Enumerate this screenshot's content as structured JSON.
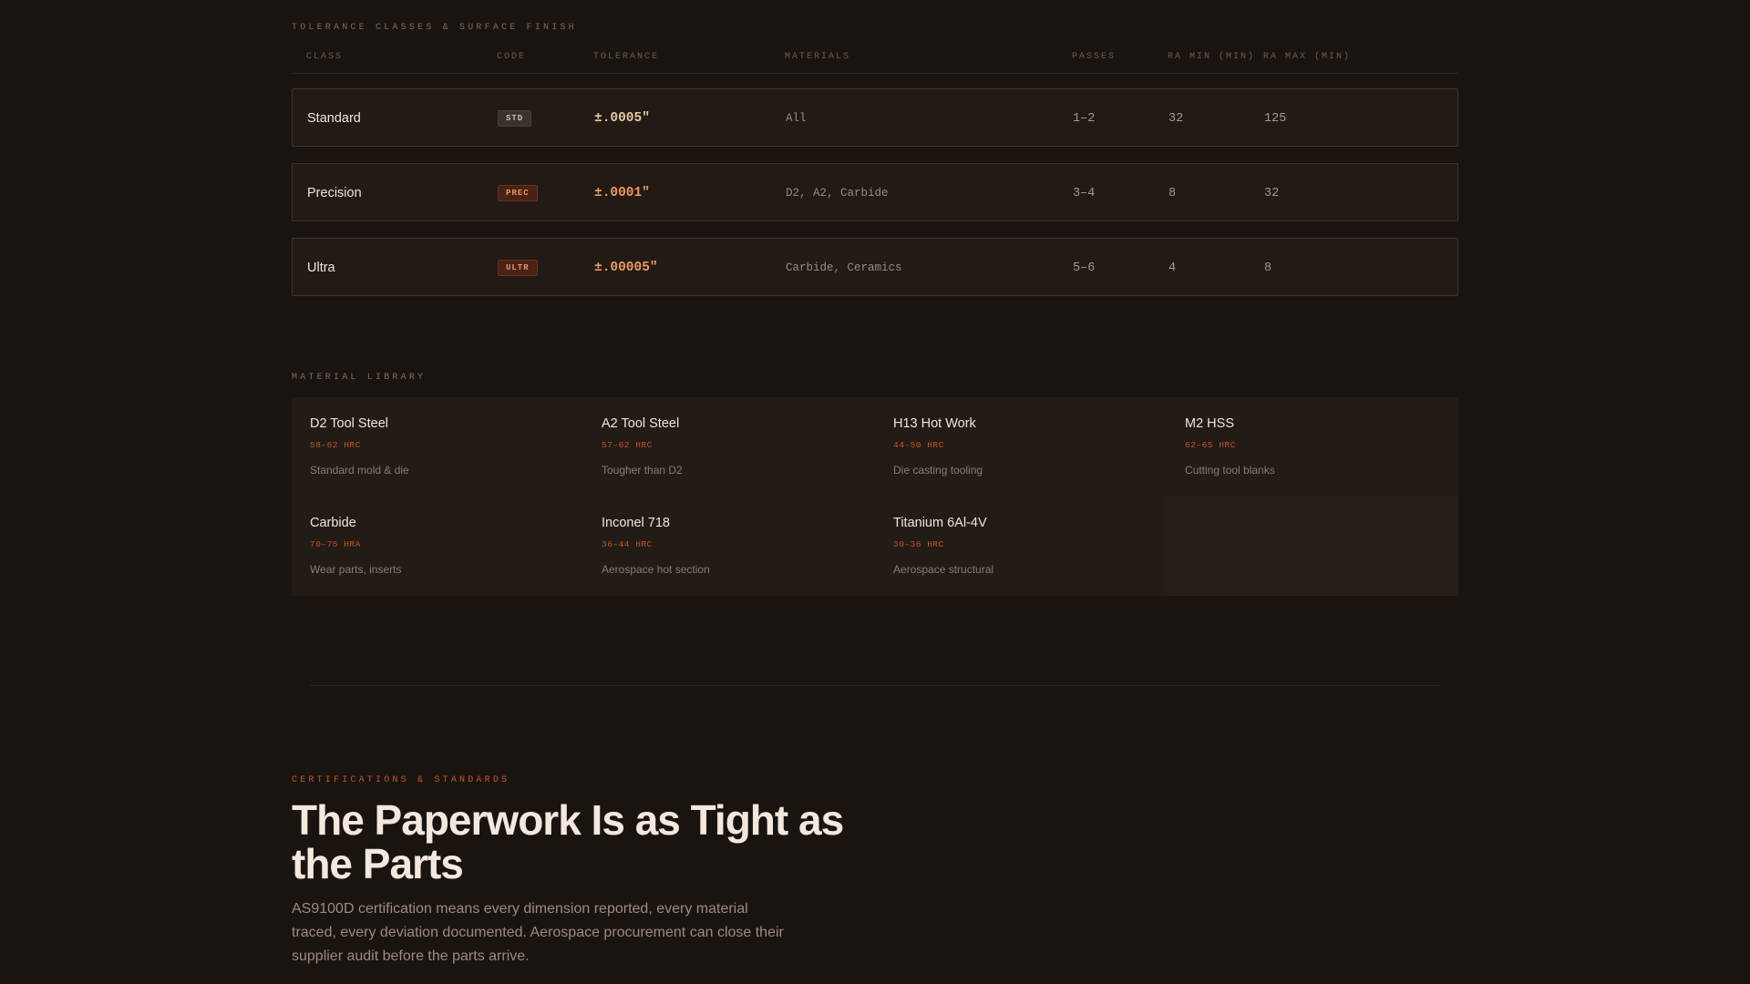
{
  "tolerance": {
    "heading": "TOLERANCE CLASSES & SURFACE FINISH",
    "columns": [
      "CLASS",
      "CODE",
      "TOLERANCE",
      "MATERIALS",
      "PASSES",
      "RA MIN (MIN)",
      "RA MAX (MIN)"
    ],
    "rows": [
      {
        "class": "Standard",
        "code": "STD",
        "tolerance": "±.0005\"",
        "materials": "All",
        "passes": "1–2",
        "ra_min": "32",
        "ra_max": "125"
      },
      {
        "class": "Precision",
        "code": "PREC",
        "tolerance": "±.0001\"",
        "materials": "D2, A2, Carbide",
        "passes": "3–4",
        "ra_min": "8",
        "ra_max": "32"
      },
      {
        "class": "Ultra",
        "code": "ULTR",
        "tolerance": "±.00005\"",
        "materials": "Carbide, Ceramics",
        "passes": "5–6",
        "ra_min": "4",
        "ra_max": "8"
      }
    ]
  },
  "materials": {
    "heading": "MATERIAL LIBRARY",
    "items": [
      {
        "name": "D2 Tool Steel",
        "hardness": "58–62 HRC",
        "desc": "Standard mold & die"
      },
      {
        "name": "A2 Tool Steel",
        "hardness": "57–62 HRC",
        "desc": "Tougher than D2"
      },
      {
        "name": "H13 Hot Work",
        "hardness": "44–50 HRC",
        "desc": "Die casting tooling"
      },
      {
        "name": "M2 HSS",
        "hardness": "62–65 HRC",
        "desc": "Cutting tool blanks"
      },
      {
        "name": "Carbide",
        "hardness": "70–75 HRA",
        "desc": "Wear parts, inserts"
      },
      {
        "name": "Inconel 718",
        "hardness": "36–44 HRC",
        "desc": "Aerospace hot section"
      },
      {
        "name": "Titanium 6Al-4V",
        "hardness": "30–36 HRC",
        "desc": "Aerospace structural"
      }
    ]
  },
  "certifications": {
    "eyebrow": "CERTIFICATIONS & STANDARDS",
    "title": "The Paperwork Is as Tight as the Parts",
    "body": "AS9100D certification means every dimension reported, every material traced, every deviation documented. Aerospace procurement can close their supplier audit before the parts arrive."
  },
  "colors": {
    "background": "#1a1410",
    "accent": "#c4581f",
    "std_badge_bg": "#3a322c",
    "std_badge_fg": "#c8bcb0",
    "prec_badge_bg": "#4a2214",
    "prec_badge_fg": "#e8956a",
    "std_tol": "#e8c8a0",
    "prec_tol": "#f09860"
  }
}
